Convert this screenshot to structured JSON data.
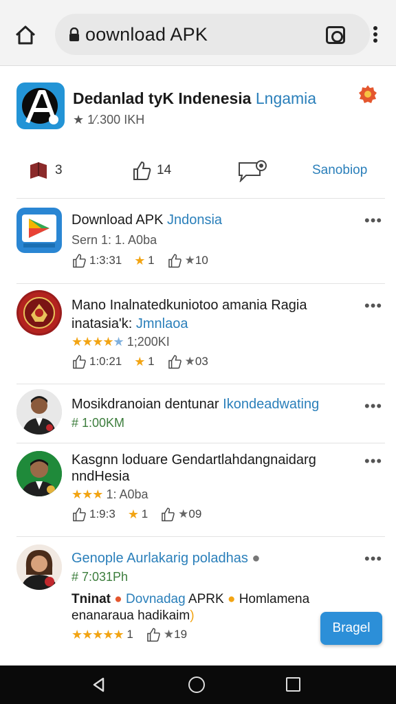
{
  "browser": {
    "url": "ownload APK",
    "url_prefix": "o"
  },
  "app": {
    "title": "Dedanlad tyK Indenesia ",
    "title_accent": "Lngamia",
    "rating": "★ 1⁄.300 IKH"
  },
  "actions": {
    "books_count": "3",
    "likes_count": "14",
    "link_label": "Sanobiop"
  },
  "items": [
    {
      "title": "Download APK ",
      "title_accent": "Jndonsia",
      "line1": "Sern 1: 1. A0ba",
      "likes": "1:3:31",
      "star_count": "1",
      "shares": "10"
    },
    {
      "title": "Mano Inalnatedkuniotoo amania Ragia",
      "title2": "inatasia'k: ",
      "title2_accent": "Jmnlaoa",
      "rating_text": "1;200KI",
      "likes": "1:0:21",
      "star_count": "1",
      "shares": "03"
    },
    {
      "title": "Mosikdranoian dentunar ",
      "title_accent": "Ikondeadwating",
      "line1": "# 1:00KM"
    },
    {
      "title": "Kasgnn loduare Gendartlahdangnaidarg",
      "title2": "nndHesia",
      "rating_text": "1: A0ba",
      "likes": "1:9:3",
      "star_count": "1",
      "shares": "09"
    },
    {
      "title": "Genople Aurlakarig poladhas",
      "line1": "# 7:031Ph",
      "body1": "Tninat ",
      "body1_accent": "Dovnadag ",
      "body1_rest": "APRK ",
      "body1_end": "Homlamena",
      "body2": "enanaraua hadikaim",
      "star_count": "1",
      "shares": "19"
    }
  ],
  "fab_label": "Bragel",
  "colors": {
    "accent": "#2a7fba",
    "star": "#f2a413",
    "fab": "#2c8fd8"
  }
}
